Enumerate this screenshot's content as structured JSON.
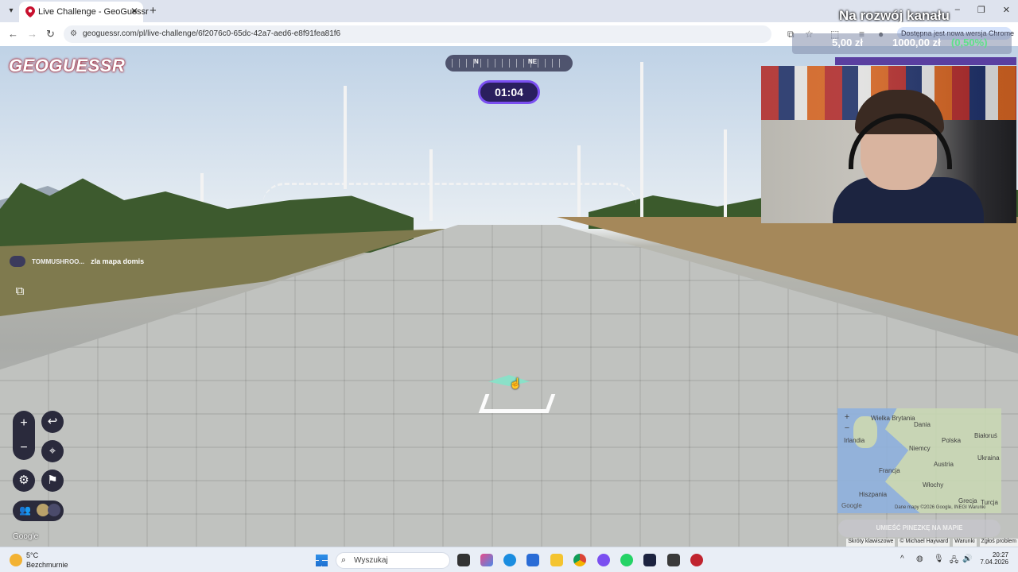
{
  "browser": {
    "tab_title": "Live Challenge - GeoGuessr",
    "url": "geoguessr.com/pl/live-challenge/6f2076c0-65dc-42a7-aed6-e8f91fea81f6",
    "update_notice": "Dostępna jest nowa wersja Chrome",
    "overlay_title": "Na rozwój kanału"
  },
  "stock_overlay": {
    "current": "5,00 zł",
    "target": "1000,00 zł",
    "percent": "(0,50%)"
  },
  "game": {
    "logo": "GEOGUESSR",
    "compass_n": "N",
    "compass_ne": "NE",
    "timer": "01:04",
    "chat_user": "TOMMUSHROO...",
    "chat_message": "zla mapa domis",
    "guess_button": "UMIEŚĆ PINEZKĘ NA MAPIE",
    "google_watermark": "Google"
  },
  "minimap": {
    "labels": [
      "Wielka Brytania",
      "Irlandia",
      "Dania",
      "Polska",
      "Białoruś",
      "Niemcy",
      "Ukraina",
      "Austria",
      "Francja",
      "Włochy",
      "Hiszpania",
      "Grecja",
      "Turcja"
    ],
    "attribution": "Dane mapy ©2026 Google, INEGI",
    "terms": "Warunki",
    "google": "Google"
  },
  "footer_links": [
    "Skróty klawiszowe",
    "© Michael Hayward",
    "Warunki",
    "Zgłoś problem"
  ],
  "taskbar": {
    "temp": "5°C",
    "weather": "Bezchmurnie",
    "search_placeholder": "Wyszukaj",
    "time": "20:27",
    "date": "7.04.2026"
  },
  "colors": {
    "accent_purple": "#7a4ff0",
    "timer_bg": "#2a1f5e",
    "logo_red": "#a01020"
  }
}
